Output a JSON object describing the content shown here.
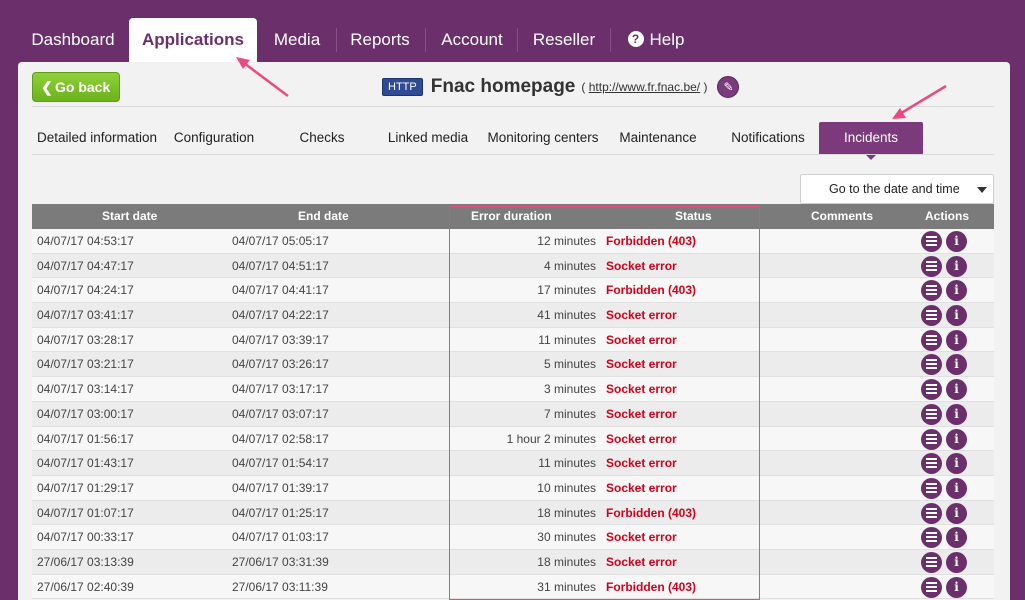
{
  "nav": {
    "items": [
      "Dashboard",
      "Applications",
      "Media",
      "Reports",
      "Account",
      "Reseller"
    ],
    "help": "Help",
    "active": "Applications"
  },
  "header": {
    "back_label": "Go back",
    "badge": "HTTP",
    "title": "Fnac homepage",
    "url": "http://www.fr.fnac.be/",
    "url_open": "(",
    "url_close": ")"
  },
  "tabs": [
    "Detailed information",
    "Configuration",
    "Checks",
    "Linked media",
    "Monitoring centers",
    "Maintenance",
    "Notifications",
    "Incidents"
  ],
  "active_tab": "Incidents",
  "goto_label": "Go to the date and time",
  "table": {
    "headers": [
      "Start date",
      "End date",
      "Error duration",
      "Status",
      "Comments",
      "Actions"
    ],
    "rows": [
      {
        "start": "04/07/17 04:53:17",
        "end": "04/07/17 05:05:17",
        "duration": "12 minutes",
        "status": "Forbidden (403)"
      },
      {
        "start": "04/07/17 04:47:17",
        "end": "04/07/17 04:51:17",
        "duration": "4 minutes",
        "status": "Socket error"
      },
      {
        "start": "04/07/17 04:24:17",
        "end": "04/07/17 04:41:17",
        "duration": "17 minutes",
        "status": "Forbidden (403)"
      },
      {
        "start": "04/07/17 03:41:17",
        "end": "04/07/17 04:22:17",
        "duration": "41 minutes",
        "status": "Socket error"
      },
      {
        "start": "04/07/17 03:28:17",
        "end": "04/07/17 03:39:17",
        "duration": "11 minutes",
        "status": "Socket error"
      },
      {
        "start": "04/07/17 03:21:17",
        "end": "04/07/17 03:26:17",
        "duration": "5 minutes",
        "status": "Socket error"
      },
      {
        "start": "04/07/17 03:14:17",
        "end": "04/07/17 03:17:17",
        "duration": "3 minutes",
        "status": "Socket error"
      },
      {
        "start": "04/07/17 03:00:17",
        "end": "04/07/17 03:07:17",
        "duration": "7 minutes",
        "status": "Socket error"
      },
      {
        "start": "04/07/17 01:56:17",
        "end": "04/07/17 02:58:17",
        "duration": "1 hour 2 minutes",
        "status": "Socket error"
      },
      {
        "start": "04/07/17 01:43:17",
        "end": "04/07/17 01:54:17",
        "duration": "11 minutes",
        "status": "Socket error"
      },
      {
        "start": "04/07/17 01:29:17",
        "end": "04/07/17 01:39:17",
        "duration": "10 minutes",
        "status": "Socket error"
      },
      {
        "start": "04/07/17 01:07:17",
        "end": "04/07/17 01:25:17",
        "duration": "18 minutes",
        "status": "Forbidden (403)"
      },
      {
        "start": "04/07/17 00:33:17",
        "end": "04/07/17 01:03:17",
        "duration": "30 minutes",
        "status": "Socket error"
      },
      {
        "start": "27/06/17 03:13:39",
        "end": "27/06/17 03:31:39",
        "duration": "18 minutes",
        "status": "Socket error"
      },
      {
        "start": "27/06/17 02:40:39",
        "end": "27/06/17 03:11:39",
        "duration": "31 minutes",
        "status": "Forbidden (403)"
      }
    ]
  },
  "icons": {
    "help": "help-icon",
    "back": "chevron-left-icon",
    "edit": "pencil-icon",
    "row_action_1": "list-add-icon",
    "row_action_2": "info-icon"
  },
  "colors": {
    "brand": "#6b2f6c",
    "go_back": "#7dc22a",
    "error": "#d0021b",
    "annotation": "#e94b7e"
  }
}
